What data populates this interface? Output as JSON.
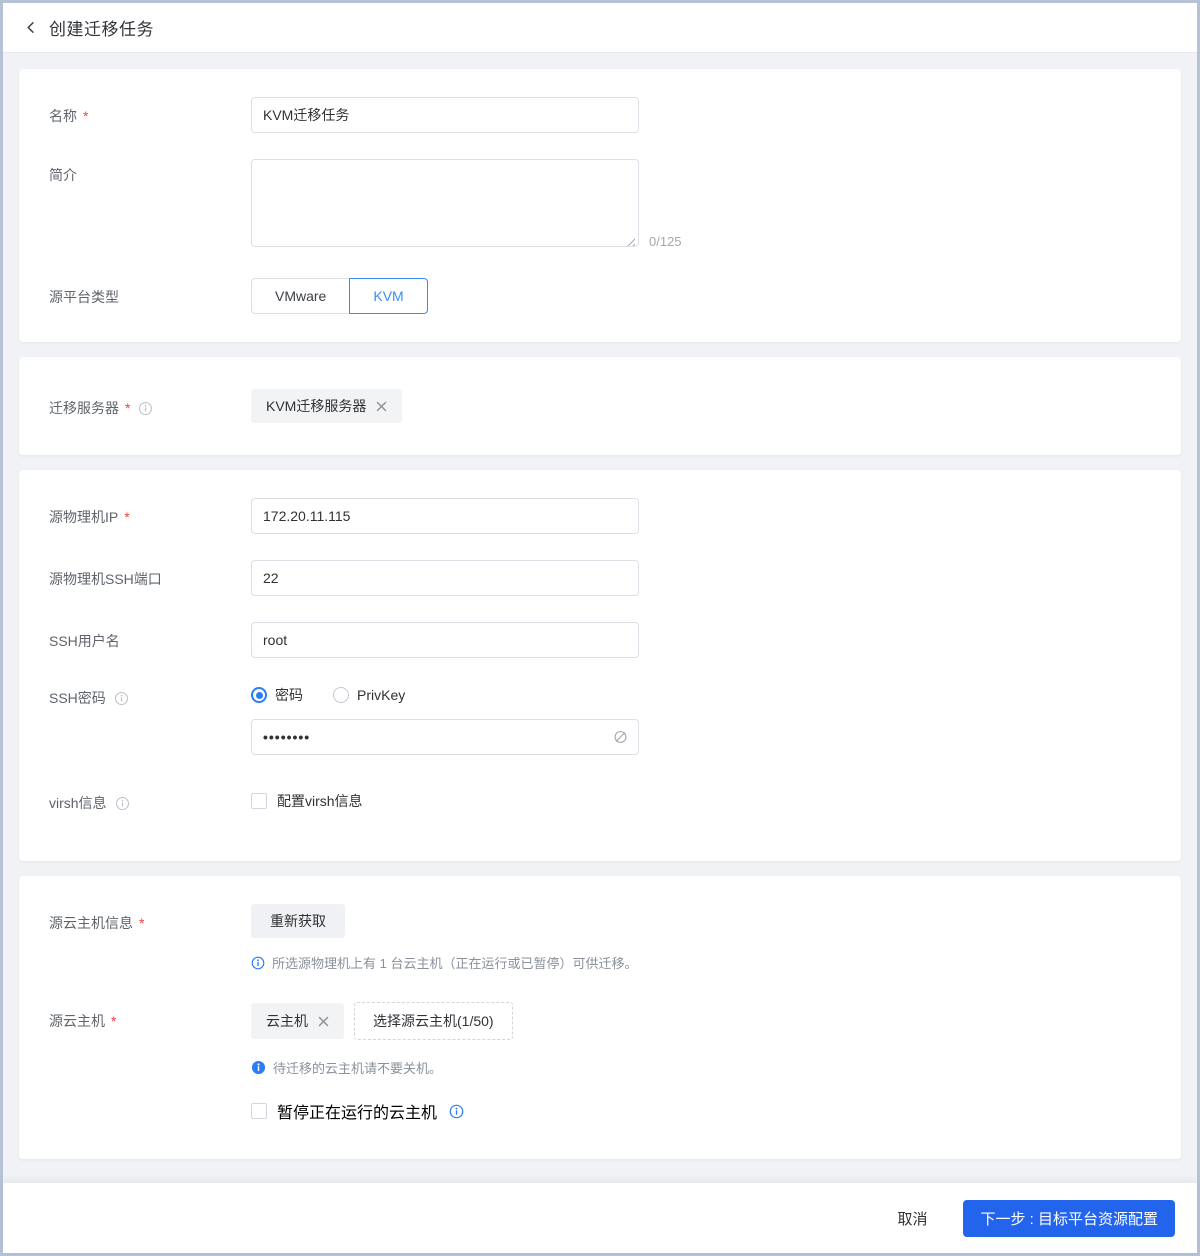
{
  "colors": {
    "primary": "#2264ec",
    "accent": "#3b8cf7",
    "danger": "#f53f3f",
    "page_background": "#f0f2f5",
    "page_border": "#b6c3d7"
  },
  "ui": {
    "required_marker": "*"
  },
  "header": {
    "title": "创建迁移任务",
    "back_icon": "chevron-left"
  },
  "basic": {
    "name_label": "名称",
    "name_value": "KVM迁移任务",
    "desc_label": "简介",
    "desc_value": "",
    "desc_counter": "0/125",
    "platform_label": "源平台类型",
    "platform_options": [
      {
        "label": "VMware",
        "selected": false
      },
      {
        "label": "KVM",
        "selected": true
      }
    ]
  },
  "server": {
    "label": "迁移服务器",
    "tag": "KVM迁移服务器"
  },
  "source": {
    "ip_label": "源物理机IP",
    "ip_value": "172.20.11.115",
    "port_label": "源物理机SSH端口",
    "port_value": "22",
    "user_label": "SSH用户名",
    "user_value": "root",
    "password_label": "SSH密码",
    "password_options": [
      "密码",
      "PrivKey"
    ],
    "password_selected": "密码",
    "password_masked": "••••••••",
    "virsh_label": "virsh信息",
    "virsh_checkbox_label": "配置virsh信息",
    "virsh_checked": false
  },
  "vms": {
    "info_label": "源云主机信息",
    "refresh_button": "重新获取",
    "info_tip": "所选源物理机上有 1 台云主机（正在运行或已暂停）可供迁移。",
    "vm_label": "源云主机",
    "vm_tag": "云主机",
    "select_button": "选择源云主机(1/50)",
    "vm_tip": "待迁移的云主机请不要关机。",
    "pause_checkbox_label": "暂停正在运行的云主机",
    "pause_checked": false
  },
  "footer": {
    "cancel": "取消",
    "next": "下一步 : 目标平台资源配置"
  }
}
